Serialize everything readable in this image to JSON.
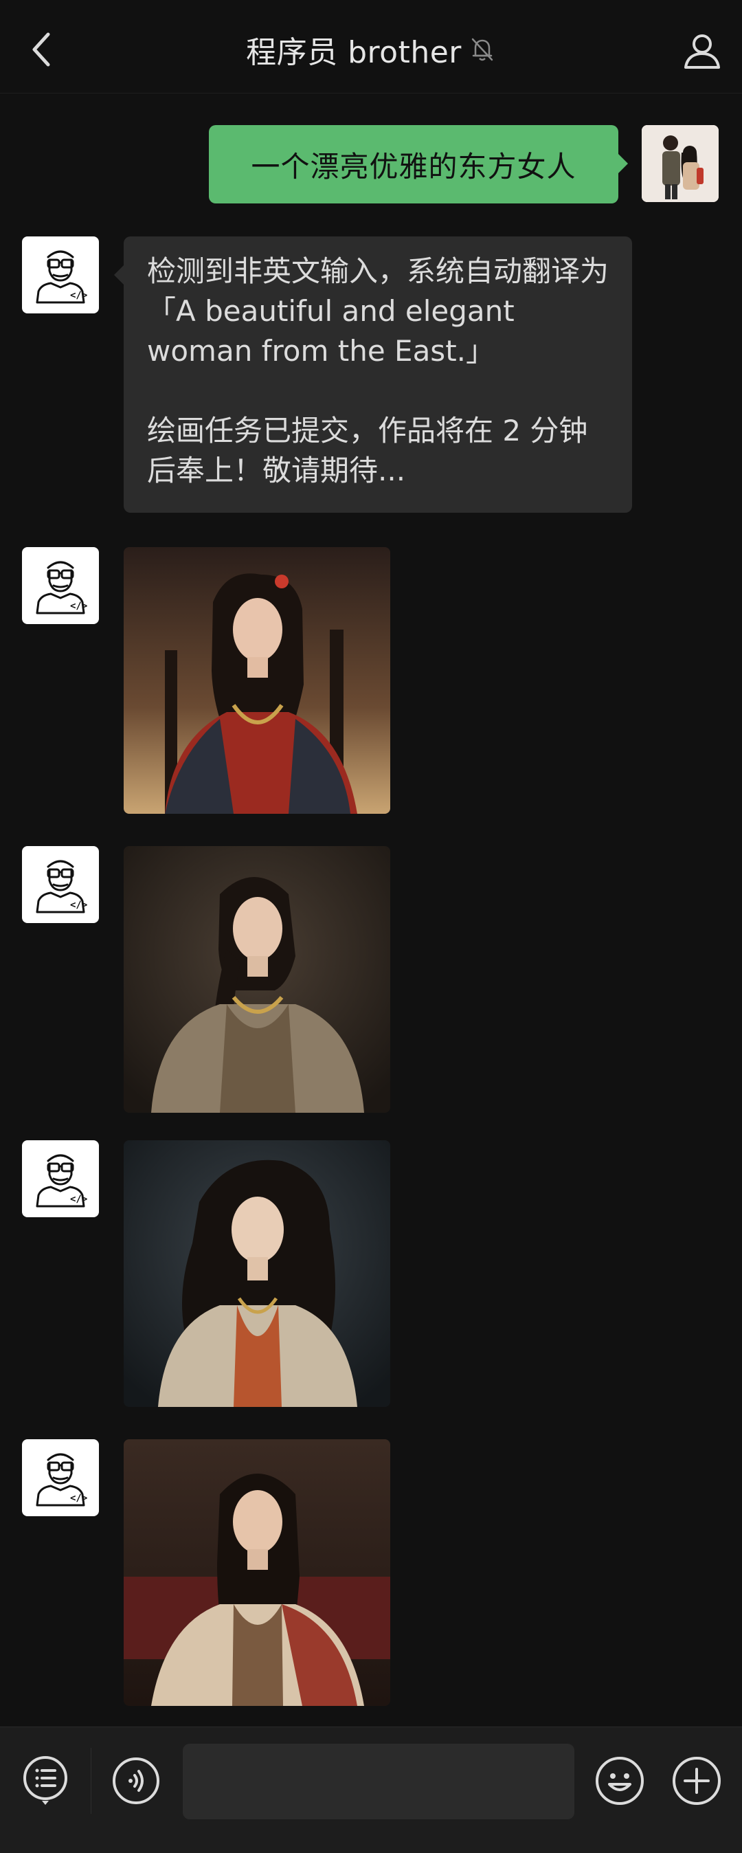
{
  "header": {
    "title": "程序员 brother",
    "back_icon": "chevron-left-icon",
    "mute_icon": "bell-off-icon",
    "profile_icon": "person-icon"
  },
  "messages": [
    {
      "sender": "user",
      "type": "text",
      "text": "一个漂亮优雅的东方女人"
    },
    {
      "sender": "bot",
      "type": "text",
      "line1": "检测到非英文输入，系统自动翻译为「A beautiful and elegant woman from the East.」",
      "line2": "绘画任务已提交，作品将在 2 分钟后奉上！敬请期待..."
    },
    {
      "sender": "bot",
      "type": "image"
    },
    {
      "sender": "bot",
      "type": "image"
    },
    {
      "sender": "bot",
      "type": "image"
    },
    {
      "sender": "bot",
      "type": "image"
    }
  ],
  "input": {
    "value": "",
    "placeholder": ""
  },
  "bottom_bar": {
    "menu_icon": "menu-list-icon",
    "voice_icon": "voice-icon",
    "emoji_icon": "emoji-icon",
    "plus_icon": "plus-icon"
  },
  "colors": {
    "background": "#111111",
    "user_bubble": "#5bba6f",
    "bot_bubble": "#2c2c2c",
    "bottom_bar": "#1d1d1d"
  }
}
